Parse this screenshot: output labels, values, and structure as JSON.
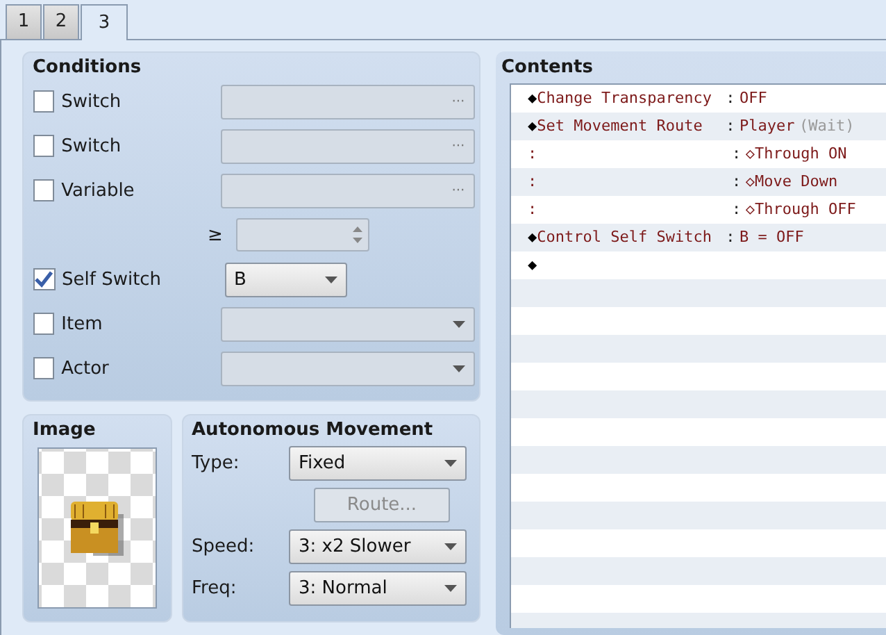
{
  "tabs": [
    {
      "label": "1",
      "selected": false
    },
    {
      "label": "2",
      "selected": false
    },
    {
      "label": "3",
      "selected": true
    }
  ],
  "conditions": {
    "title": "Conditions",
    "rows": [
      {
        "kind": "picker",
        "label": "Switch",
        "checked": false,
        "value_icon": "···"
      },
      {
        "kind": "picker",
        "label": "Switch",
        "checked": false,
        "value_icon": "···"
      },
      {
        "kind": "picker",
        "label": "Variable",
        "checked": false,
        "value_icon": "···"
      },
      {
        "kind": "spin",
        "operator": "≥"
      },
      {
        "kind": "select",
        "label": "Self Switch",
        "checked": true,
        "value": "B"
      },
      {
        "kind": "select-wide",
        "label": "Item",
        "checked": false
      },
      {
        "kind": "select-wide",
        "label": "Actor",
        "checked": false
      }
    ]
  },
  "image": {
    "title": "Image"
  },
  "movement": {
    "title": "Autonomous Movement",
    "rows": [
      {
        "kind": "select",
        "label": "Type:",
        "value": "Fixed"
      },
      {
        "kind": "button",
        "label": "Route...",
        "disabled": true
      },
      {
        "kind": "select",
        "label": "Speed:",
        "value": "3: x2 Slower"
      },
      {
        "kind": "select",
        "label": "Freq:",
        "value": "3: Normal"
      }
    ]
  },
  "contents": {
    "title": "Contents",
    "rows": [
      {
        "kind": "command",
        "marker": "◆",
        "name": "Change Transparency",
        "separator": ":",
        "value": "OFF"
      },
      {
        "kind": "command",
        "marker": "◆",
        "name": "Set Movement Route",
        "separator": ":",
        "value": "Player",
        "note": "(Wait)"
      },
      {
        "kind": "step",
        "lead": ":",
        "separator": ":",
        "value": "◇Through ON"
      },
      {
        "kind": "step",
        "lead": ":",
        "separator": ":",
        "value": "◇Move Down"
      },
      {
        "kind": "step",
        "lead": ":",
        "separator": ":",
        "value": "◇Through OFF"
      },
      {
        "kind": "command",
        "marker": "◆",
        "name": "Control Self Switch",
        "separator": ":",
        "value": "B = OFF"
      },
      {
        "kind": "command",
        "marker": "◆"
      }
    ]
  }
}
